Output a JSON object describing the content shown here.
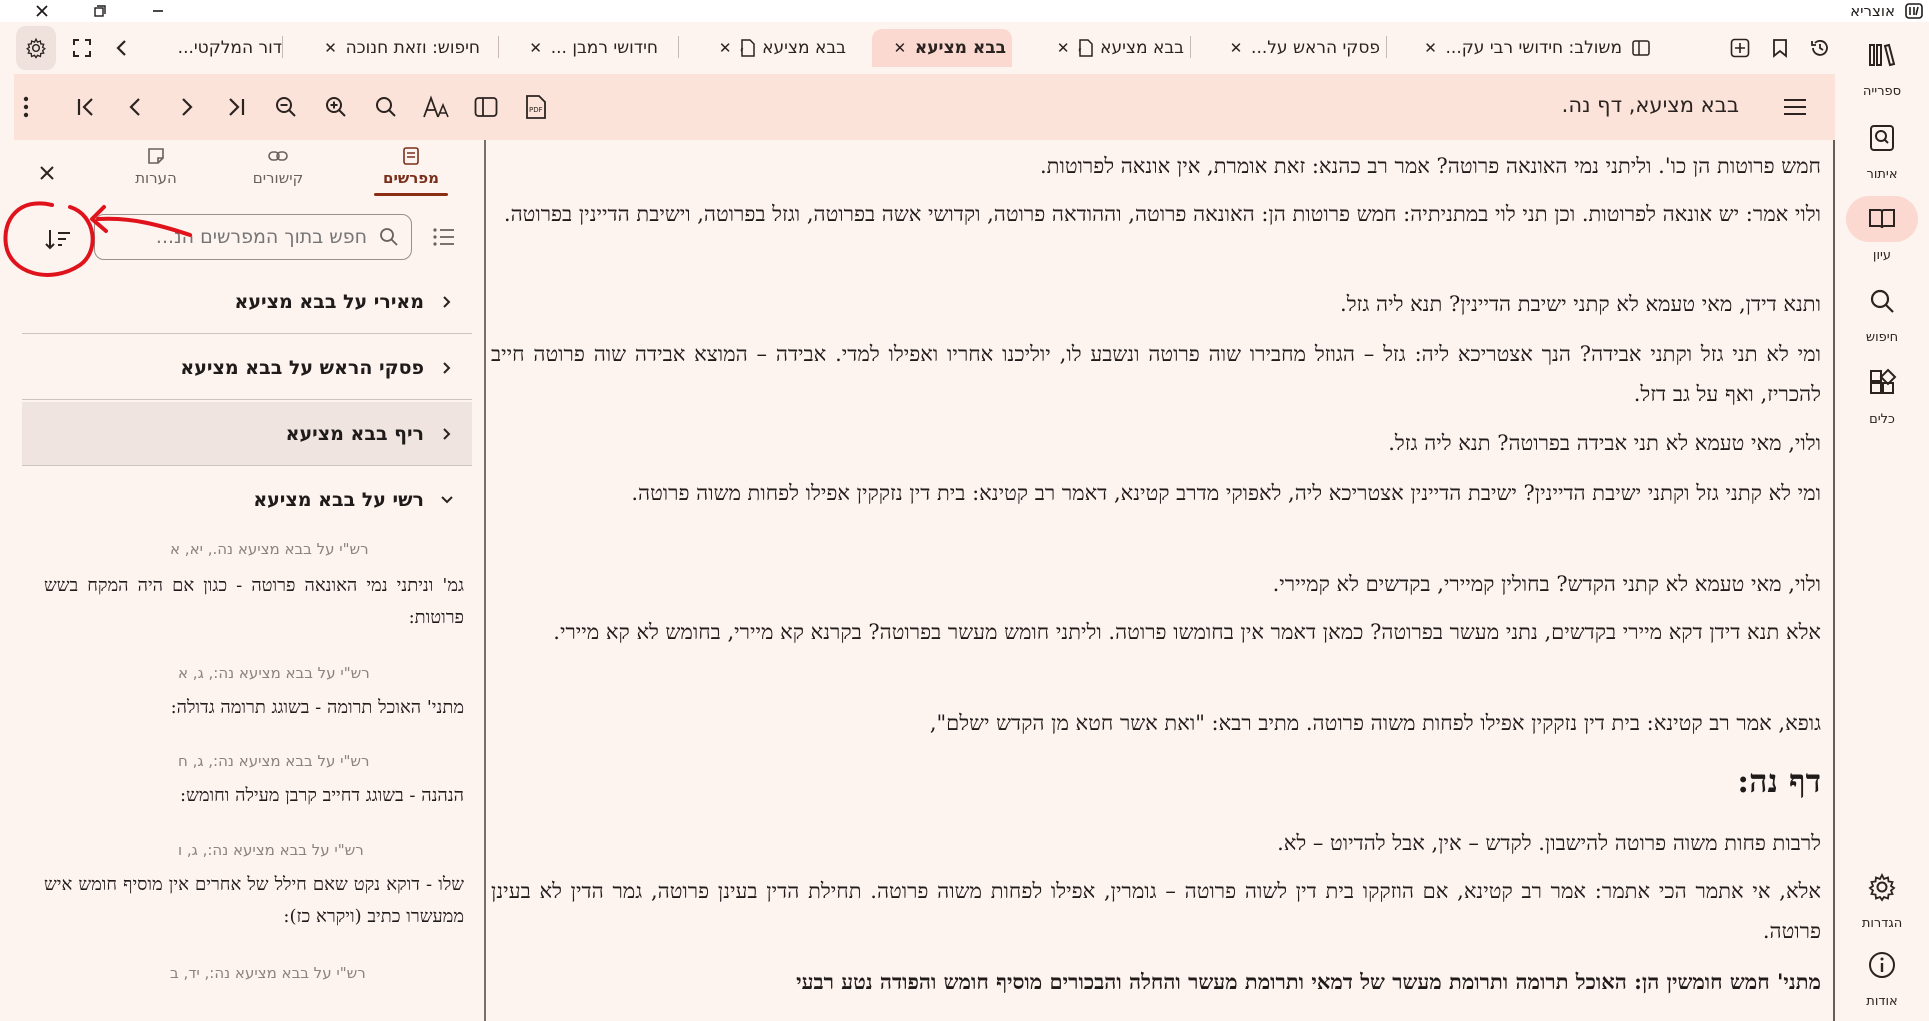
{
  "app": {
    "title": "אוצריא"
  },
  "tabs": [
    {
      "label": "משולב: חידושי רבי עק...",
      "icon": "split-view-icon",
      "active": false
    },
    {
      "label": "פסקי הראש על...",
      "icon": "",
      "active": false
    },
    {
      "label": "בבא מציעא",
      "icon": "pdf-icon",
      "active": false
    },
    {
      "label": "בבא מציעא",
      "icon": "",
      "active": true
    },
    {
      "label": "בבא מציעא",
      "icon": "pdf-icon",
      "active": false
    },
    {
      "label": "חידושי רמבן ...",
      "icon": "",
      "active": false
    },
    {
      "label": "חיפוש: וזאת חנוכה",
      "icon": "",
      "active": false
    },
    {
      "label": "דור המלקטי...",
      "icon": "",
      "active": false
    }
  ],
  "toolbar": {
    "doc_title": "בבא מציעא, דף נה."
  },
  "rail": [
    {
      "label": "ספרייה",
      "icon": "library-icon",
      "active": false
    },
    {
      "label": "איתור",
      "icon": "find-ref-icon",
      "active": false
    },
    {
      "label": "עיון",
      "icon": "book-open-icon",
      "active": true
    },
    {
      "label": "חיפוש",
      "icon": "search-icon",
      "active": false
    },
    {
      "label": "כלים",
      "icon": "tools-icon",
      "active": false
    },
    {
      "label": "הגדרות",
      "icon": "gear-icon",
      "active": false
    },
    {
      "label": "אודות",
      "icon": "info-icon",
      "active": false
    }
  ],
  "side_panel": {
    "tabs": [
      {
        "label": "מפרשים",
        "icon": "commentary-icon",
        "active": true
      },
      {
        "label": "קישורים",
        "icon": "link-icon",
        "active": false
      },
      {
        "label": "הערות",
        "icon": "note-icon",
        "active": false
      }
    ],
    "search_placeholder": "חפש בתוך המפרשים הנ...",
    "commentaries": [
      {
        "name": "מאירי על בבא מציעא",
        "expanded": false
      },
      {
        "name": "פסקי הראש על בבא מציעא",
        "expanded": false
      },
      {
        "name": "ריף בבא מציעא",
        "expanded": false
      },
      {
        "name": "רשי על בבא מציעא",
        "expanded": true
      }
    ],
    "entries": [
      {
        "ref": "רש\"י על בבא מציעא נה., יא, א",
        "text": "גמ' וניתני נמי האונאה פרוטה - כגון אם היה המקח בשש פרוטות:"
      },
      {
        "ref": "רש\"י על בבא מציעא נה:, ג, א",
        "text": "מתני' האוכל תרומה - בשוגג תרומה גדולה:"
      },
      {
        "ref": "רש\"י על בבא מציעא נה:, ג, ח",
        "text": "הנהנה - בשוגג דחייב קרבן מעילה וחומש:"
      },
      {
        "ref": "רש\"י על בבא מציעא נה:, ג, ו",
        "text": "שלו - דוקא נקט שאם חילל של אחרים אין מוסיף חומש איש ממעשרו כתיב (ויקרא כז):"
      },
      {
        "ref": "רש\"י על בבא מציעא נה:, יד, ב",
        "text": ""
      }
    ]
  },
  "main_text": {
    "paragraphs": [
      "חמש פרוטות הן כו'. וליתני נמי האונאה פרוטה? אמר רב כהנא: זאת אומרת, אין אונאה לפרוטות.",
      "ולוי אמר: יש אונאה לפרוטות. וכן תני לוי במתניתיה: חמש פרוטות הן: האונאה פרוטה, וההודאה פרוטה, וקדושי אשה בפרוטה, וגזל בפרוטה, וישיבת הדיינין בפרוטה.",
      "ותנא דידן, מאי טעמא לא קתני ישיבת הדיינין? תנא ליה גזל.",
      "ומי לא תני גזל וקתני אבידה? הנך אצטריכא ליה: גזל – הגוזל מחבירו שוה פרוטה ונשבע לו, יוליכנו אחריו ואפילו למדי. אבידה – המוצא אבידה שוה פרוטה חייב להכריז, ואף על גב דזל.",
      "ולוי, מאי טעמא לא תני אבידה בפרוטה? תנא ליה גזל.",
      "ומי לא קתני גזל וקתני ישיבת הדיינין? ישיבת הדיינין אצטריכא ליה, לאפוקי מדרב קטינא, דאמר רב קטינא: בית דין נזקקין אפילו לפחות משוה פרוטה.",
      "ולוי, מאי טעמא לא קתני הקדש? בחולין קמיירי, בקדשים לא קמיירי.",
      "אלא תנא דידן דקא מיירי בקדשים, נתני מעשר בפרוטה? כמאן דאמר אין בחומשו פרוטה. וליתני חומש מעשר בפרוטה? בקרנא קא מיירי, בחומש לא קא מיירי.",
      "גופא, אמר רב קטינא: בית דין נזקקין אפילו לפחות משוה פרוטה. מתיב רבא: \"ואת אשר חטא מן הקדש ישלם\",",
      "לרבות פחות משוה פרוטה להישבון. לקדש – אין, אבל להדיוט – לא.",
      "אלא, אי אתמר הכי אתמר: אמר רב קטינא, אם הוזקקו בית דין לשוה פרוטה – גומרין, אפילו לפחות משוה פרוטה. תחילת הדין בעינן פרוטה, גמר הדין לא בעינן פרוטה.",
      "מתני' חמש חומשין הן: האוכל תרומה ותרומת מעשר של דמאי ותרומת מעשר והחלה והבכורים מוסיף חומש והפודה נטע רבעי"
    ],
    "heading": "דף נה:"
  },
  "colors": {
    "accent": "#8b2e14",
    "active_bg": "#fbd9d1",
    "toolbar_bg": "#fbe3da",
    "page_bg": "#fdf3ef",
    "annotation": "#e0131c"
  }
}
